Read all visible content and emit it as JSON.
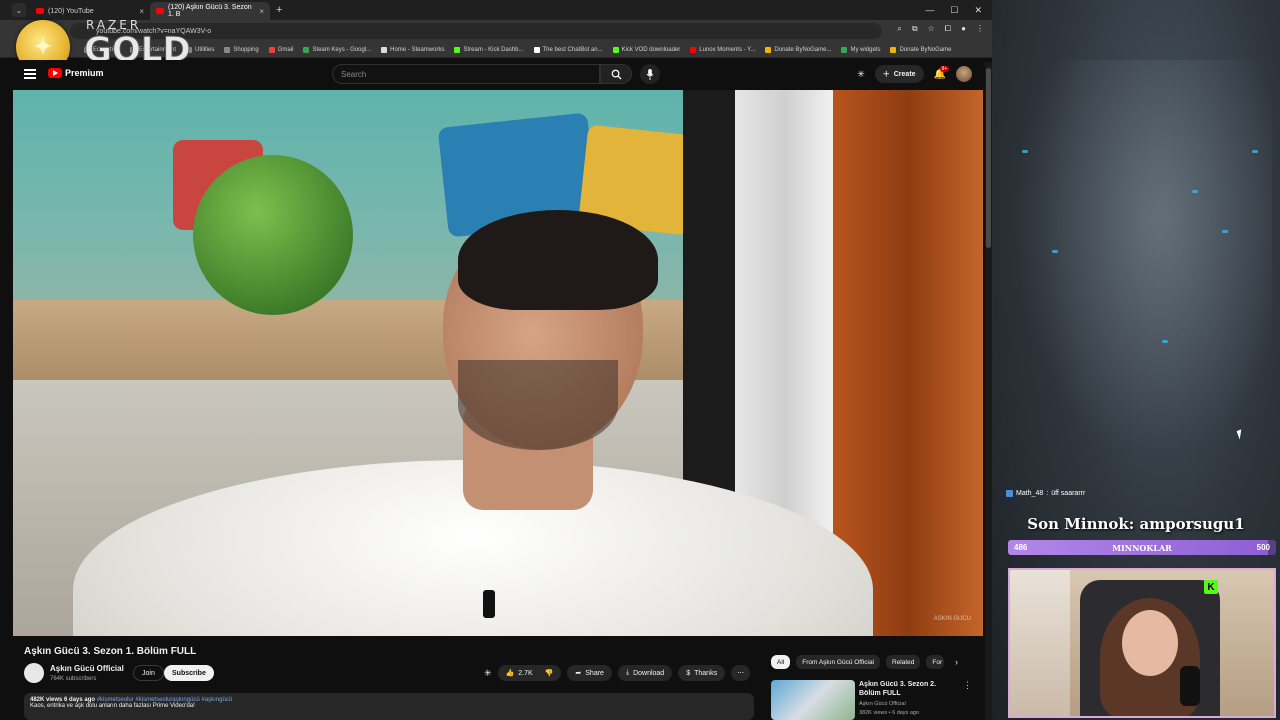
{
  "browser": {
    "tabs": [
      {
        "title": "(120) YouTube"
      },
      {
        "title": "(120) Aşkın Gücü 3. Sezon 1. B"
      }
    ],
    "new_tab": "+",
    "url": "youtube.com/watch?v=naYQAW3V-o",
    "bookmarks": [
      {
        "label": "Education"
      },
      {
        "label": "Entertainment"
      },
      {
        "label": "Utilities"
      },
      {
        "label": "Shopping"
      },
      {
        "label": "Gmail"
      },
      {
        "label": "Steam Keys - Googl..."
      },
      {
        "label": "Home - Steamworks"
      },
      {
        "label": "Stream - Kick Dashb..."
      },
      {
        "label": "The best ChatBot an..."
      },
      {
        "label": "Kick VOD downloader"
      },
      {
        "label": "Lunox Moments - Y..."
      },
      {
        "label": "Donate ByNoGame..."
      },
      {
        "label": "My widgets"
      },
      {
        "label": "Donate ByNoGame"
      }
    ]
  },
  "razer": {
    "brand": "RAZER",
    "tier": "GOLD"
  },
  "youtube": {
    "logo_label": "Premium",
    "search_placeholder": "Search",
    "create_label": "Create",
    "notif_count": "9+",
    "video_watermark": "ASKIN GUCU",
    "video_title": "Aşkın Gücü 3. Sezon 1. Bölüm FULL",
    "channel_name": "Aşkın Gücü Official",
    "channel_subs": "764K subscribers",
    "join_label": "Join",
    "subscribe_label": "Subscribe",
    "likes": "2.7K",
    "share_label": "Share",
    "download_label": "Download",
    "thanks_label": "Thanks",
    "desc_meta": "482K views  6 days ago",
    "desc_tags": "#kismetseolur #kismetseoluraşkıngücü #aşkıngücü",
    "desc_line2": "Kaos, entrika ve aşk dolu anların daha fazlası Prime Video'da!",
    "chips": [
      "All",
      "From Aşkın Gücü Official",
      "Related",
      "For"
    ],
    "rec": {
      "title": "Aşkın Gücü 3. Sezon 2. Bölüm FULL",
      "channel": "Aşkın Gücü Official",
      "views": "382K views • 6 days ago"
    }
  },
  "overlay": {
    "chat_user": "Math_48",
    "chat_text": "üff saararrr",
    "minnok_title": "Son Minnok: amporsugu1",
    "bar_min": "486",
    "bar_label": "MINNOKLAR",
    "bar_max": "500",
    "bar_progress": 0.972,
    "kick_badge": "K"
  },
  "colors": {
    "accent": "#ff0000",
    "kick": "#53fc18",
    "bar": "#8e5fd4"
  }
}
